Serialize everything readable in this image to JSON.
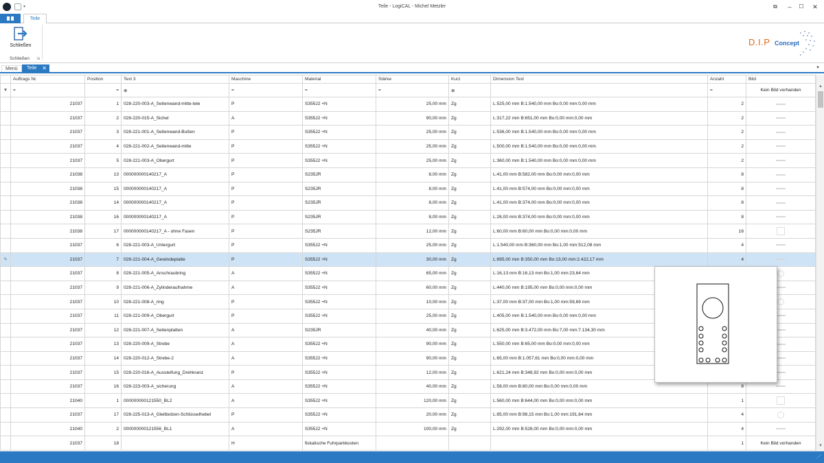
{
  "window": {
    "title": "Teile - LogiCAL - Michel Metzler"
  },
  "ribbon": {
    "tab": "Teile",
    "close_button_label": "Schließen",
    "group_label": "Schließen",
    "logo_dip": "D.I.P",
    "logo_concept": "Concept"
  },
  "doc_tabs": {
    "menu": "Menü",
    "active": "Teile"
  },
  "columns": [
    "Auftrags Nr.",
    "Position",
    "Text 3",
    "Maschine",
    "Material",
    "Stärke",
    "Kurz",
    "Dimension Text",
    "Anzahl",
    "Bild"
  ],
  "filter": {
    "bild": "Kein Bild vorhanden"
  },
  "rows": [
    {
      "auftrag": "21037",
      "pos": "1",
      "text": "028-220-003-A_Seitenwand-mitte-tele",
      "maschine": "P",
      "material": "S355J2 +N",
      "staerke": "25,00 mm",
      "kurz": "Zg",
      "dim": "L:525,00 mm B:1.540,00 mm Bo:0,00 mm:0,00 mm",
      "anzahl": "2",
      "bild": "line"
    },
    {
      "auftrag": "21037",
      "pos": "2",
      "text": "028-220-015-A_Sichel",
      "maschine": "A",
      "material": "S355J2 +N",
      "staerke": "90,00 mm",
      "kurz": "Zg",
      "dim": "L:317,22 mm B:651,00 mm Bo:0,00 mm:0,00 mm",
      "anzahl": "2",
      "bild": "line"
    },
    {
      "auftrag": "21037",
      "pos": "3",
      "text": "028-221-001-A_Seitenwand-Bußen",
      "maschine": "P",
      "material": "S355J2 +N",
      "staerke": "25,00 mm",
      "kurz": "Zg",
      "dim": "L:536,00 mm B:1.540,00 mm Bo:0,00 mm:0,00 mm",
      "anzahl": "2",
      "bild": "line"
    },
    {
      "auftrag": "21037",
      "pos": "4",
      "text": "028-221-002-A_Seitenwand-mitte",
      "maschine": "P",
      "material": "S355J2 +N",
      "staerke": "25,00 mm",
      "kurz": "Zg",
      "dim": "L:500,00 mm B:1.540,00 mm Bo:0,00 mm:0,00 mm",
      "anzahl": "2",
      "bild": "line"
    },
    {
      "auftrag": "21037",
      "pos": "5",
      "text": "028-221-003-A_Obergurt",
      "maschine": "P",
      "material": "S355J2 +N",
      "staerke": "25,00 mm",
      "kurz": "Zg",
      "dim": "L:360,00 mm B:1.540,00 mm Bo:0,00 mm:0,00 mm",
      "anzahl": "2",
      "bild": "line"
    },
    {
      "auftrag": "21038",
      "pos": "13",
      "text": "000000000140217_A",
      "maschine": "P",
      "material": "S235JR",
      "staerke": "8,00 mm",
      "kurz": "Zg",
      "dim": "L:41,00 mm B:582,00 mm Bo:0,00 mm:0,00 mm",
      "anzahl": "8",
      "bild": "line"
    },
    {
      "auftrag": "21038",
      "pos": "15",
      "text": "000000000140217_A",
      "maschine": "P",
      "material": "S235JR",
      "staerke": "8,00 mm",
      "kurz": "Zg",
      "dim": "L:41,00 mm B:574,00 mm Bo:0,00 mm:0,00 mm",
      "anzahl": "8",
      "bild": "line"
    },
    {
      "auftrag": "21038",
      "pos": "14",
      "text": "000000000140217_A",
      "maschine": "P",
      "material": "S235JR",
      "staerke": "8,00 mm",
      "kurz": "Zg",
      "dim": "L:41,00 mm B:374,00 mm Bo:0,00 mm:0,00 mm",
      "anzahl": "8",
      "bild": "line"
    },
    {
      "auftrag": "21038",
      "pos": "16",
      "text": "000000000140217_A",
      "maschine": "P",
      "material": "S235JR",
      "staerke": "8,00 mm",
      "kurz": "Zg",
      "dim": "L:26,00 mm B:374,00 mm Bo:0,00 mm:0,00 mm",
      "anzahl": "8",
      "bild": "line"
    },
    {
      "auftrag": "21038",
      "pos": "17",
      "text": "000000000140217_A - ohne Fasen",
      "maschine": "P",
      "material": "S235JR",
      "staerke": "12,00 mm",
      "kurz": "Zg",
      "dim": "L:60,00 mm B:60,00 mm Bo:0,00 mm:0,00 mm",
      "anzahl": "16",
      "bild": "rect"
    },
    {
      "auftrag": "21037",
      "pos": "6",
      "text": "028-221-003-A_Untergurt",
      "maschine": "P",
      "material": "S355J2 +N",
      "staerke": "25,00 mm",
      "kurz": "Zg",
      "dim": "L:1.540,00 mm B:360,00 mm Bo:1,00 mm:512,08 mm",
      "anzahl": "4",
      "bild": "line"
    },
    {
      "auftrag": "21037",
      "pos": "7",
      "text": "028-221-004-A_Gewindeplatte",
      "maschine": "P",
      "material": "S355J2 +N",
      "staerke": "30,00 mm",
      "kurz": "Zg",
      "dim": "L:895,00 mm B:350,00 mm Bo:13,00 mm:2.422,17 mm",
      "anzahl": "4",
      "bild": "line",
      "selected": true
    },
    {
      "auftrag": "21037",
      "pos": "8",
      "text": "028-221-005-A_Anschraubring",
      "maschine": "A",
      "material": "S355J2 +N",
      "staerke": "65,00 mm",
      "kurz": "Zg",
      "dim": "L:16,13 mm B:16,13 mm Bo:1,00 mm:23,64 mm",
      "anzahl": "",
      "bild": "circle"
    },
    {
      "auftrag": "21037",
      "pos": "9",
      "text": "028-221-006-A_Zylinderaufnahme",
      "maschine": "A",
      "material": "S355J2 +N",
      "staerke": "60,00 mm",
      "kurz": "Zg",
      "dim": "L:440,00 mm B:195,00 mm Bo:0,00 mm:0,00 mm",
      "anzahl": "",
      "bild": "line"
    },
    {
      "auftrag": "21037",
      "pos": "10",
      "text": "028-221-008-A_ring",
      "maschine": "P",
      "material": "S355J2 +N",
      "staerke": "10,00 mm",
      "kurz": "Zg",
      "dim": "L:37,00 mm B:37,00 mm Bo:1,00 mm:59,69 mm",
      "anzahl": "",
      "bild": "circle"
    },
    {
      "auftrag": "21037",
      "pos": "11",
      "text": "028-221-009-A_Obergurt",
      "maschine": "P",
      "material": "S355J2 +N",
      "staerke": "25,00 mm",
      "kurz": "Zg",
      "dim": "L:405,00 mm B:1.540,00 mm Bo:0,00 mm:0,00 mm",
      "anzahl": "",
      "bild": "line"
    },
    {
      "auftrag": "21037",
      "pos": "12",
      "text": "028-221-007-A_Seitenplatten",
      "maschine": "A",
      "material": "S235JR",
      "staerke": "40,00 mm",
      "kurz": "Zg",
      "dim": "L:625,00 mm B:3.472,00 mm Bo:7,00 mm:7.134,30 mm",
      "anzahl": "",
      "bild": "line"
    },
    {
      "auftrag": "21037",
      "pos": "13",
      "text": "028-220-009-A_Strebe",
      "maschine": "A",
      "material": "S355J2 +N",
      "staerke": "90,00 mm",
      "kurz": "Zg",
      "dim": "L:550,00 mm B:65,00 mm Bo:0,00 mm:0,00 mm",
      "anzahl": "",
      "bild": "line"
    },
    {
      "auftrag": "21037",
      "pos": "14",
      "text": "028-220-012-A_Strebe-2",
      "maschine": "A",
      "material": "S355J2 +N",
      "staerke": "90,00 mm",
      "kurz": "Zg",
      "dim": "L:65,00 mm B:1.057,61 mm Bo:0,00 mm:0,00 mm",
      "anzahl": "",
      "bild": "line"
    },
    {
      "auftrag": "21037",
      "pos": "15",
      "text": "028-220-016-A_Aussteifung_Drehkranz",
      "maschine": "P",
      "material": "S355J2 +N",
      "staerke": "12,00 mm",
      "kurz": "Zg",
      "dim": "L:621,24 mm B:348,92 mm Bo:0,00 mm:0,00 mm",
      "anzahl": "",
      "bild": "line"
    },
    {
      "auftrag": "21037",
      "pos": "16",
      "text": "028-223-003-A_sicherung",
      "maschine": "A",
      "material": "S355J2 +N",
      "staerke": "40,00 mm",
      "kurz": "Zg",
      "dim": "L:58,00 mm B:80,00 mm Bo:0,00 mm:0,00 mm",
      "anzahl": "8",
      "bild": "line"
    },
    {
      "auftrag": "21040",
      "pos": "1",
      "text": "000000000121550_BL2",
      "maschine": "A",
      "material": "S355J2 +N",
      "staerke": "120,00 mm",
      "kurz": "Zg",
      "dim": "L:560,00 mm B:644,00 mm Bo:0,00 mm:0,00 mm",
      "anzahl": "1",
      "bild": "rect"
    },
    {
      "auftrag": "21037",
      "pos": "17",
      "text": "028-225-013-A_Gleitbolzen-Schlüsselhebel",
      "maschine": "P",
      "material": "S355J2 +N",
      "staerke": "20,00 mm",
      "kurz": "Zg",
      "dim": "L:85,00 mm B:98,15 mm Bo:1,00 mm:191,64 mm",
      "anzahl": "4",
      "bild": "circle"
    },
    {
      "auftrag": "21040",
      "pos": "2",
      "text": "000000000121556_BL1",
      "maschine": "A",
      "material": "S355J2 +N",
      "staerke": "100,00 mm",
      "kurz": "Zg",
      "dim": "L:292,00 mm B:528,00 mm Bo:0,00 mm:0,00 mm",
      "anzahl": "4",
      "bild": "line"
    },
    {
      "auftrag": "21037",
      "pos": "18",
      "text": "",
      "maschine": "H",
      "material": "fiskalische Fuhrparkkosten",
      "staerke": "",
      "kurz": "",
      "dim": "",
      "anzahl": "1",
      "bild": "none",
      "bild_text": "Kein Bild vorhanden"
    }
  ]
}
